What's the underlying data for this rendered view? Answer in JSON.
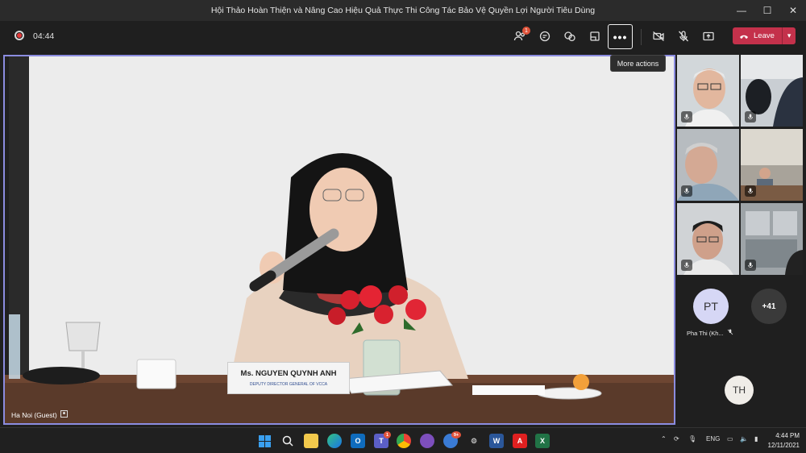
{
  "window": {
    "title": "Hội Thảo Hoàn Thiện và Nâng Cao Hiệu Quả Thực Thi Công Tác Bảo Vệ Quyền Lợi Người Tiêu Dùng",
    "minimize": "—",
    "maximize": "☐",
    "close": "✕"
  },
  "toolbar": {
    "timer": "04:44",
    "participants_badge": "1",
    "more_label": "•••",
    "more_tooltip": "More actions",
    "leave_label": "Leave"
  },
  "stage": {
    "participant_label": "Ha Noi (Guest)",
    "nameplate_name": "Ms. NGUYEN QUYNH ANH",
    "nameplate_title": "DEPUTY DIRECTOR GENERAL OF VCCA"
  },
  "side_panel": {
    "avatar_pt_initials": "PT",
    "avatar_pt_name": "Pha Thi (Kh...",
    "overflow_count": "+41",
    "avatar_th_initials": "TH"
  },
  "taskbar": {
    "teams_badge": "1",
    "chat_badge": "9+",
    "language": "ENG",
    "time": "4:44 PM",
    "date": "12/11/2021"
  }
}
